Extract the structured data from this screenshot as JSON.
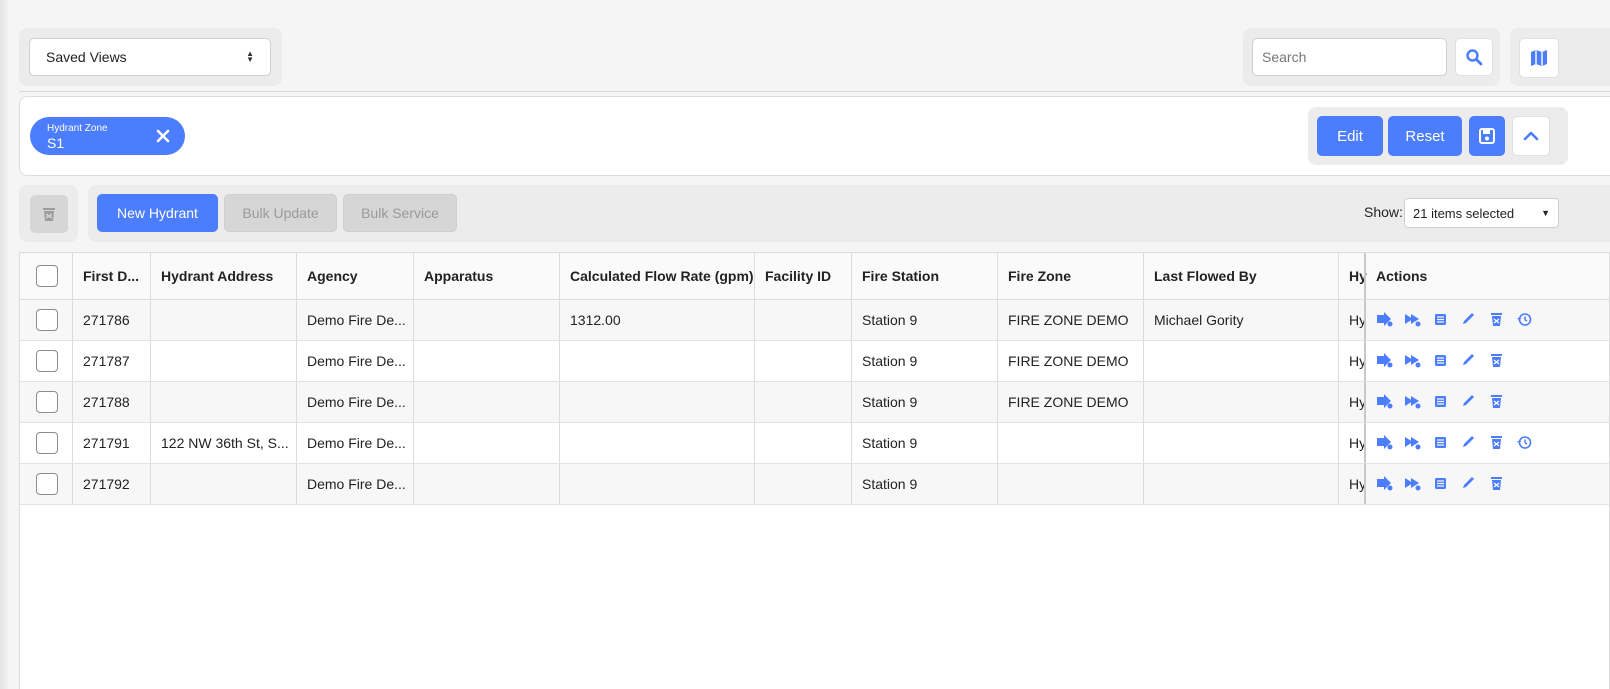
{
  "top": {
    "saved_views": "Saved Views",
    "search_placeholder": "Search"
  },
  "filters": {
    "chip_label": "Hydrant Zone",
    "chip_value": "S1",
    "edit": "Edit",
    "reset": "Reset"
  },
  "toolbar": {
    "new_hydrant": "New Hydrant",
    "bulk_update": "Bulk Update",
    "bulk_service": "Bulk Service",
    "show_label": "Show:",
    "show_value": "21 items selected"
  },
  "table": {
    "headers": [
      "First D...",
      "Hydrant Address",
      "Agency",
      "Apparatus",
      "Calculated Flow Rate (gpm)",
      "Facility ID",
      "Fire Station",
      "Fire Zone",
      "Last Flowed By",
      "Hy",
      "Actions"
    ],
    "rows": [
      {
        "first": "271786",
        "address": "",
        "agency": "Demo Fire De...",
        "apparatus": "",
        "flow": "1312.00",
        "facility": "",
        "station": "Station 9",
        "zone": "FIRE ZONE DEMO",
        "flowed_by": "Michael Gority",
        "hy": "Hy",
        "history": true
      },
      {
        "first": "271787",
        "address": "",
        "agency": "Demo Fire De...",
        "apparatus": "",
        "flow": "",
        "facility": "",
        "station": "Station 9",
        "zone": "FIRE ZONE DEMO",
        "flowed_by": "",
        "hy": "Hy",
        "history": false
      },
      {
        "first": "271788",
        "address": "",
        "agency": "Demo Fire De...",
        "apparatus": "",
        "flow": "",
        "facility": "",
        "station": "Station 9",
        "zone": "FIRE ZONE DEMO",
        "flowed_by": "",
        "hy": "Hy",
        "history": false
      },
      {
        "first": "271791",
        "address": "122 NW 36th St, S...",
        "agency": "Demo Fire De...",
        "apparatus": "",
        "flow": "",
        "facility": "",
        "station": "Station 9",
        "zone": "",
        "flowed_by": "",
        "hy": "Hy",
        "history": true
      },
      {
        "first": "271792",
        "address": "",
        "agency": "Demo Fire De...",
        "apparatus": "",
        "flow": "",
        "facility": "",
        "station": "Station 9",
        "zone": "",
        "flowed_by": "",
        "hy": "Hy",
        "history": false
      }
    ]
  },
  "colors": {
    "accent": "#4c7dfc",
    "disabled": "#d6d6d6"
  },
  "icons": [
    "search-icon",
    "map-icon",
    "close-icon",
    "save-icon",
    "chevron-up-icon",
    "trash-icon",
    "inspect-icon",
    "flow-icon",
    "list-icon",
    "edit-icon",
    "delete-icon",
    "history-icon"
  ]
}
